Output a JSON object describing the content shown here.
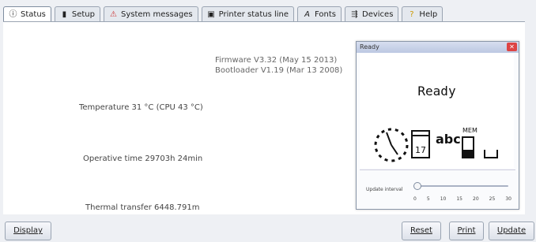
{
  "tabs": [
    {
      "label": "Status",
      "icon": "info-icon",
      "active": true
    },
    {
      "label": "Setup",
      "icon": "setup-icon",
      "active": false
    },
    {
      "label": "System messages",
      "icon": "warning-icon",
      "active": false
    },
    {
      "label": "Printer status line",
      "icon": "status-line-icon",
      "active": false
    },
    {
      "label": "Fonts",
      "icon": "font-icon",
      "active": false
    },
    {
      "label": "Devices",
      "icon": "devices-icon",
      "active": false
    },
    {
      "label": "Help",
      "icon": "help-icon",
      "active": false
    }
  ],
  "info": {
    "firmware": "Firmware V3.32 (May 15 2013)",
    "bootloader": "Bootloader V1.19 (Mar 13 2008)",
    "temperature": "Temperature 31 °C (CPU 43 °C)",
    "operative_time": "Operative time 29703h 24min",
    "thermal_transfer": "Thermal transfer 6448.791m"
  },
  "status_window": {
    "title": "Ready",
    "ready_text": "Ready",
    "calendar_day": "17",
    "abc_label": "abc",
    "mem_label": "MEM",
    "interval_label": "Update interval",
    "ticks": [
      "0",
      "5",
      "10",
      "15",
      "20",
      "25",
      "30"
    ],
    "slider_value_fraction": 0
  },
  "buttons": {
    "display": "Display",
    "reset": "Reset",
    "print": "Print",
    "update": "Update"
  },
  "colors": {
    "accent": "#7f8da0",
    "close": "#dd4444"
  }
}
